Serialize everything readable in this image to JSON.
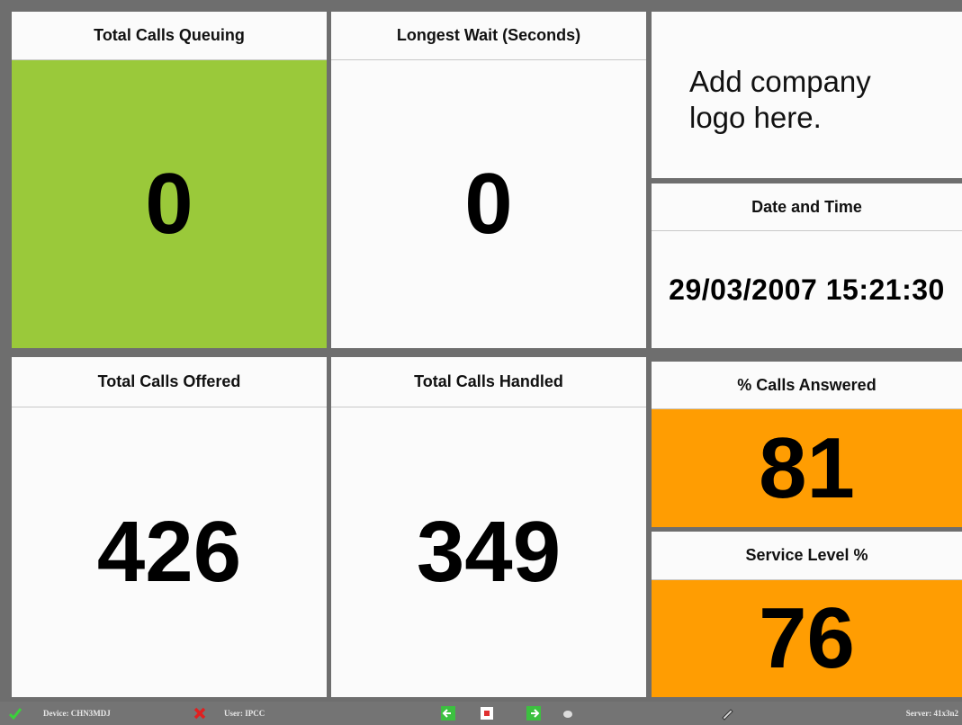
{
  "colors": {
    "background": "#6e6e6e",
    "panel": "#fbfbfb",
    "green": "#9ac93a",
    "orange": "#ff9d02",
    "statusbar": "#747474"
  },
  "panels": {
    "queuing": {
      "title": "Total Calls Queuing",
      "value": "0"
    },
    "longest_wait": {
      "title": "Longest Wait (Seconds)",
      "value": "0"
    },
    "logo": {
      "text_line1": "Add company",
      "text_line2": "logo here."
    },
    "datetime": {
      "title": "Date and Time",
      "value": "29/03/2007 15:21:30"
    },
    "offered": {
      "title": "Total Calls Offered",
      "value": "426"
    },
    "handled": {
      "title": "Total Calls Handled",
      "value": "349"
    },
    "answered": {
      "title": "% Calls Answered",
      "value": "81"
    },
    "service_level": {
      "title": "Service Level %",
      "value": "76"
    }
  },
  "statusbar": {
    "device": "Device: CHN3MDJ",
    "user": "User: IPCC",
    "server": "Server: 41x3n2",
    "icons": [
      "check-icon",
      "error-x-icon",
      "back-icon",
      "stop-icon",
      "forward-icon",
      "circle-icon",
      "pen-icon"
    ]
  }
}
